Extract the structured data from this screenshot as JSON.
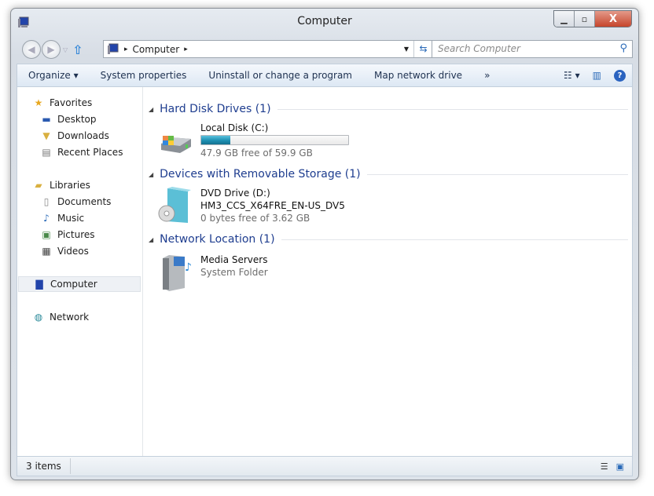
{
  "window": {
    "title": "Computer"
  },
  "address": {
    "crumbs": [
      "Computer"
    ],
    "separator": "▸"
  },
  "search": {
    "placeholder": "Search Computer"
  },
  "toolbar": {
    "organize": "Organize",
    "system_properties": "System properties",
    "uninstall": "Uninstall or change a program",
    "map_drive": "Map network drive",
    "more": "»"
  },
  "sidebar": {
    "favorites": {
      "label": "Favorites",
      "items": [
        {
          "label": "Desktop"
        },
        {
          "label": "Downloads"
        },
        {
          "label": "Recent Places"
        }
      ]
    },
    "libraries": {
      "label": "Libraries",
      "items": [
        {
          "label": "Documents"
        },
        {
          "label": "Music"
        },
        {
          "label": "Pictures"
        },
        {
          "label": "Videos"
        }
      ]
    },
    "computer": "Computer",
    "network": "Network"
  },
  "groups": [
    {
      "title": "Hard Disk Drives (1)",
      "items": [
        {
          "name": "Local Disk (C:)",
          "used_fraction": 0.2,
          "detail": "47.9 GB free of 59.9 GB"
        }
      ]
    },
    {
      "title": "Devices with Removable Storage (1)",
      "items": [
        {
          "name": "DVD Drive (D:)",
          "label": "HM3_CCS_X64FRE_EN-US_DV5",
          "detail": "0 bytes free of 3.62 GB"
        }
      ]
    },
    {
      "title": "Network Location (1)",
      "items": [
        {
          "name": "Media Servers",
          "detail": "System Folder"
        }
      ]
    }
  ],
  "status": {
    "count": "3 items"
  },
  "colors": {
    "group_header": "#1e3d8f",
    "progress": "#1e8fb2"
  }
}
